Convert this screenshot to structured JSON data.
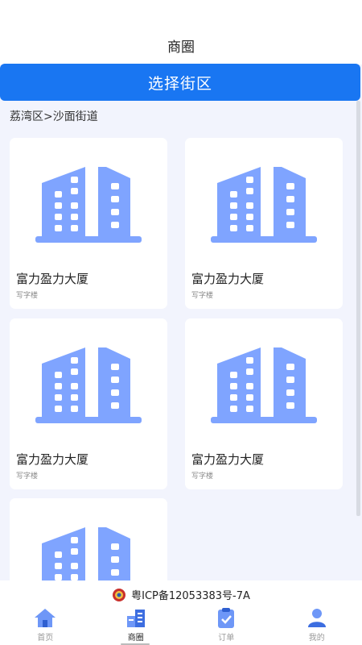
{
  "header": {
    "title": "商圈"
  },
  "select_button": {
    "label": "选择街区"
  },
  "breadcrumb": "荔湾区>沙面街道",
  "cards": [
    {
      "name": "富力盈力大厦",
      "type": "写字楼"
    },
    {
      "name": "富力盈力大厦",
      "type": "写字楼"
    },
    {
      "name": "富力盈力大厦",
      "type": "写字楼"
    },
    {
      "name": "富力盈力大厦",
      "type": "写字楼"
    },
    {
      "name": "",
      "type": ""
    }
  ],
  "footer": {
    "icp": "粤ICP备12053383号-7A",
    "tabs": [
      {
        "label": "首页",
        "icon": "home-icon"
      },
      {
        "label": "商圈",
        "icon": "buildings-icon"
      },
      {
        "label": "订单",
        "icon": "clipboard-check-icon"
      },
      {
        "label": "我的",
        "icon": "user-icon"
      }
    ],
    "active_tab": 1
  },
  "colors": {
    "accent": "#1976f2",
    "building": "#7fa4ff",
    "background": "#f2f4fd"
  }
}
